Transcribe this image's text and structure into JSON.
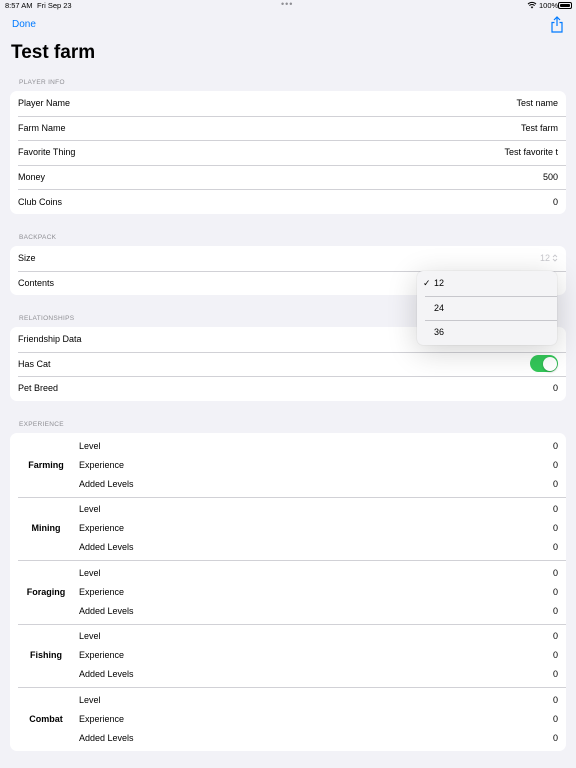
{
  "status_bar": {
    "time": "8:57 AM",
    "date": "Fri Sep 23",
    "battery": "100%"
  },
  "nav": {
    "done_label": "Done",
    "title": "Test farm"
  },
  "player_info": {
    "header": "PLAYER INFO",
    "rows": [
      {
        "label": "Player Name",
        "value": "Test name"
      },
      {
        "label": "Farm Name",
        "value": "Test farm"
      },
      {
        "label": "Favorite Thing",
        "value": "Test favorite t"
      },
      {
        "label": "Money",
        "value": "500"
      },
      {
        "label": "Club Coins",
        "value": "0"
      }
    ]
  },
  "backpack": {
    "header": "BACKPACK",
    "size_label": "Size",
    "size_value": "12",
    "contents_label": "Contents",
    "dropdown": {
      "options": [
        "12",
        "24",
        "36"
      ],
      "selected": "12"
    }
  },
  "relationships": {
    "header": "RELATIONSHIPS",
    "friendship_label": "Friendship Data",
    "has_cat_label": "Has Cat",
    "has_cat": true,
    "pet_breed_label": "Pet Breed",
    "pet_breed_value": "0"
  },
  "experience": {
    "header": "EXPERIENCE",
    "line_labels": [
      "Level",
      "Experience",
      "Added Levels"
    ],
    "skills": [
      {
        "name": "Farming",
        "level": "0",
        "experience": "0",
        "added_levels": "0"
      },
      {
        "name": "Mining",
        "level": "0",
        "experience": "0",
        "added_levels": "0"
      },
      {
        "name": "Foraging",
        "level": "0",
        "experience": "0",
        "added_levels": "0"
      },
      {
        "name": "Fishing",
        "level": "0",
        "experience": "0",
        "added_levels": "0"
      },
      {
        "name": "Combat",
        "level": "0",
        "experience": "0",
        "added_levels": "0"
      }
    ]
  },
  "colors": {
    "accent": "#007aff",
    "toggle_on": "#34c759",
    "background": "#f2f2f7"
  }
}
